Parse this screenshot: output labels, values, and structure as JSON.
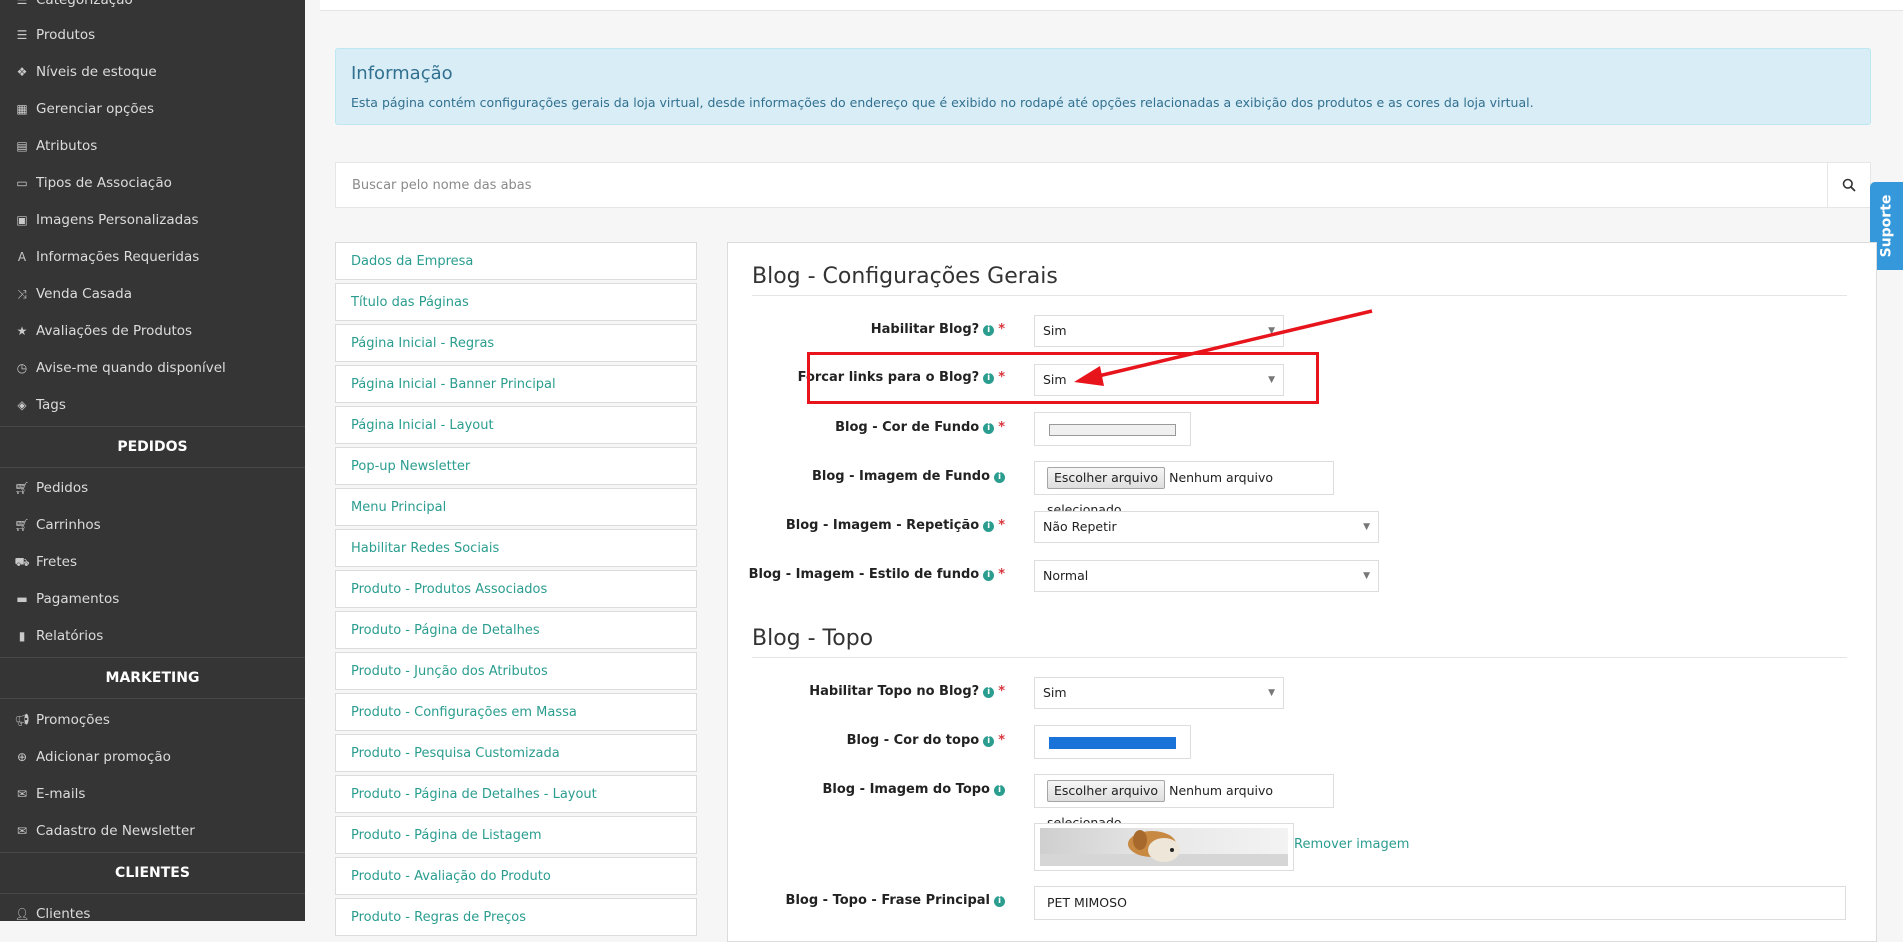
{
  "sidebar": {
    "items": [
      {
        "label": "Categorização",
        "icon": "list-icon"
      },
      {
        "label": "Produtos",
        "icon": "list-icon"
      },
      {
        "label": "Níveis de estoque",
        "icon": "cubes-icon"
      },
      {
        "label": "Gerenciar opções",
        "icon": "grid-icon"
      },
      {
        "label": "Atributos",
        "icon": "table-icon"
      },
      {
        "label": "Tipos de Associação",
        "icon": "card-icon"
      },
      {
        "label": "Imagens Personalizadas",
        "icon": "image-icon"
      },
      {
        "label": "Informações Requeridas",
        "icon": "font-icon"
      },
      {
        "label": "Venda Casada",
        "icon": "shuffle-icon"
      },
      {
        "label": "Avaliações de Produtos",
        "icon": "star-icon"
      },
      {
        "label": "Avise-me quando disponível",
        "icon": "clock-icon"
      },
      {
        "label": "Tags",
        "icon": "tag-icon"
      }
    ],
    "section_pedidos": "PEDIDOS",
    "pedidos_items": [
      {
        "label": "Pedidos",
        "icon": "cart-icon"
      },
      {
        "label": "Carrinhos",
        "icon": "cart-icon"
      },
      {
        "label": "Fretes",
        "icon": "truck-icon"
      },
      {
        "label": "Pagamentos",
        "icon": "money-icon"
      },
      {
        "label": "Relatórios",
        "icon": "bar-chart-icon"
      }
    ],
    "section_marketing": "MARKETING",
    "marketing_items": [
      {
        "label": "Promoções",
        "icon": "bullhorn-icon"
      },
      {
        "label": "Adicionar promoção",
        "icon": "plus-circle-icon"
      },
      {
        "label": "E-mails",
        "icon": "envelope-icon"
      },
      {
        "label": "Cadastro de Newsletter",
        "icon": "envelope-icon"
      }
    ],
    "section_clientes": "CLIENTES",
    "clientes_items": [
      {
        "label": "Clientes",
        "icon": "user-icon"
      }
    ]
  },
  "info": {
    "title": "Informação",
    "description": "Esta página contém configurações gerais da loja virtual, desde informações do endereço que é exibido no rodapé até opções relacionadas a exibição dos produtos e as cores da loja virtual."
  },
  "search": {
    "placeholder": "Buscar pelo nome das abas",
    "icon": "search-icon"
  },
  "support_label": "Suporte",
  "tabs": [
    "Dados da Empresa",
    "Título das Páginas",
    "Página Inicial - Regras",
    "Página Inicial - Banner Principal",
    "Página Inicial - Layout",
    "Pop-up Newsletter",
    "Menu Principal",
    "Habilitar Redes Sociais",
    "Produto - Produtos Associados",
    "Produto - Página de Detalhes",
    "Produto - Junção dos Atributos",
    "Produto - Configurações em Massa",
    "Produto - Pesquisa Customizada",
    "Produto - Página de Detalhes - Layout",
    "Produto - Página de Listagem",
    "Produto - Avaliação do Produto",
    "Produto - Regras de Preços"
  ],
  "section_general": {
    "title": "Blog - Configurações Gerais",
    "fields": {
      "habilitar_blog": {
        "label": "Habilitar Blog?",
        "value": "Sim"
      },
      "forcar_links": {
        "label": "Forcar links para o Blog?",
        "value": "Sim"
      },
      "cor_fundo": {
        "label": "Blog - Cor de Fundo",
        "color": "#f0f0f0"
      },
      "imagem_fundo": {
        "label": "Blog - Imagem de Fundo",
        "button": "Escolher arquivo",
        "status": "Nenhum arquivo selecionado"
      },
      "imagem_repeticao": {
        "label": "Blog - Imagem - Repetição",
        "value": "Não Repetir"
      },
      "imagem_estilo": {
        "label": "Blog - Imagem - Estilo de fundo",
        "value": "Normal"
      }
    }
  },
  "section_topo": {
    "title": "Blog - Topo",
    "fields": {
      "habilitar_topo": {
        "label": "Habilitar Topo no Blog?",
        "value": "Sim"
      },
      "cor_topo": {
        "label": "Blog - Cor do topo",
        "color": "#1a73d9"
      },
      "imagem_topo": {
        "label": "Blog - Imagem do Topo",
        "button": "Escolher arquivo",
        "status": "Nenhum arquivo selecionado"
      },
      "remover_imagem": "Remover imagem",
      "frase_principal": {
        "label": "Blog - Topo - Frase Principal",
        "value": "PET MIMOSO"
      }
    }
  },
  "annotation_color": "#e8141b",
  "accent_color": "#2a9d8f"
}
